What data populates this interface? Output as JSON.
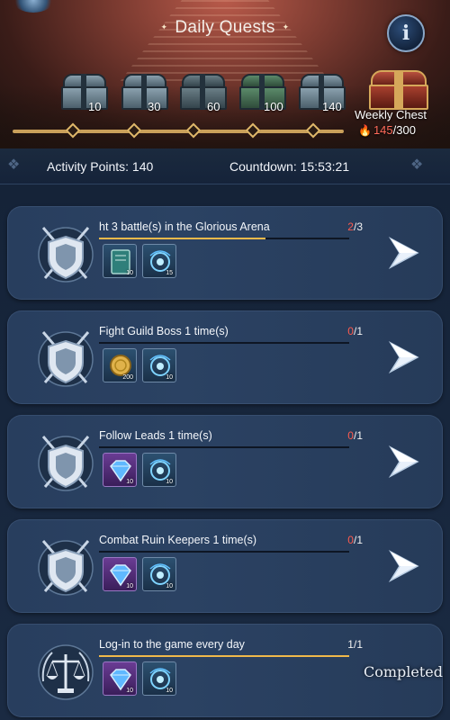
{
  "header": {
    "title": "Daily Quests",
    "info_icon": "info-icon"
  },
  "milestones": [
    {
      "points": "10",
      "chest": "steel"
    },
    {
      "points": "30",
      "chest": "steel"
    },
    {
      "points": "60",
      "chest": "dark"
    },
    {
      "points": "100",
      "chest": "green"
    },
    {
      "points": "140",
      "chest": "steel"
    }
  ],
  "weekly": {
    "label": "Weekly Chest",
    "current": "145",
    "total": "/300",
    "fraction": 0.483
  },
  "stats": {
    "activity_points": "Activity Points: 140",
    "countdown": "Countdown: 15:53:21"
  },
  "quests": [
    {
      "title": "ht 3 battle(s) in the Glorious Arena",
      "current": "2",
      "total": "/3",
      "progress": 0.667,
      "emblem": "shield-swords-icon",
      "rewards": [
        {
          "icon": "book-icon",
          "qty": "10",
          "style": "r-book"
        },
        {
          "icon": "soul-orb-icon",
          "qty": "15",
          "style": "r-soul"
        }
      ],
      "state": "go"
    },
    {
      "title": "Fight Guild Boss 1 time(s)",
      "current": "0",
      "total": "/1",
      "progress": 0,
      "emblem": "shield-swords-icon",
      "rewards": [
        {
          "icon": "gold-coin-icon",
          "qty": "200",
          "style": "r-coin"
        },
        {
          "icon": "soul-orb-icon",
          "qty": "10",
          "style": "r-soul"
        }
      ],
      "state": "go"
    },
    {
      "title": "Follow Leads 1 time(s)",
      "current": "0",
      "total": "/1",
      "progress": 0,
      "emblem": "shield-swords-icon",
      "rewards": [
        {
          "icon": "diamond-icon",
          "qty": "10",
          "style": "r-gem"
        },
        {
          "icon": "soul-orb-icon",
          "qty": "10",
          "style": "r-soul"
        }
      ],
      "state": "go"
    },
    {
      "title": "Combat Ruin Keepers 1 time(s)",
      "current": "0",
      "total": "/1",
      "progress": 0,
      "emblem": "shield-swords-icon",
      "rewards": [
        {
          "icon": "diamond-icon",
          "qty": "10",
          "style": "r-gem"
        },
        {
          "icon": "soul-orb-icon",
          "qty": "10",
          "style": "r-soul"
        }
      ],
      "state": "go"
    },
    {
      "title": "Log-in to the game every day",
      "current": "1",
      "total": "/1",
      "progress": 1,
      "emblem": "scales-icon",
      "rewards": [
        {
          "icon": "diamond-icon",
          "qty": "10",
          "style": "r-gem"
        },
        {
          "icon": "soul-orb-icon",
          "qty": "10",
          "style": "r-soul"
        }
      ],
      "state": "completed",
      "status_label": "Completed"
    }
  ],
  "colors": {
    "progress_fill": "#f0b94a",
    "count_current": "#ff5b4e",
    "panel": "#2b4263",
    "track_gold": "#caa05a"
  }
}
